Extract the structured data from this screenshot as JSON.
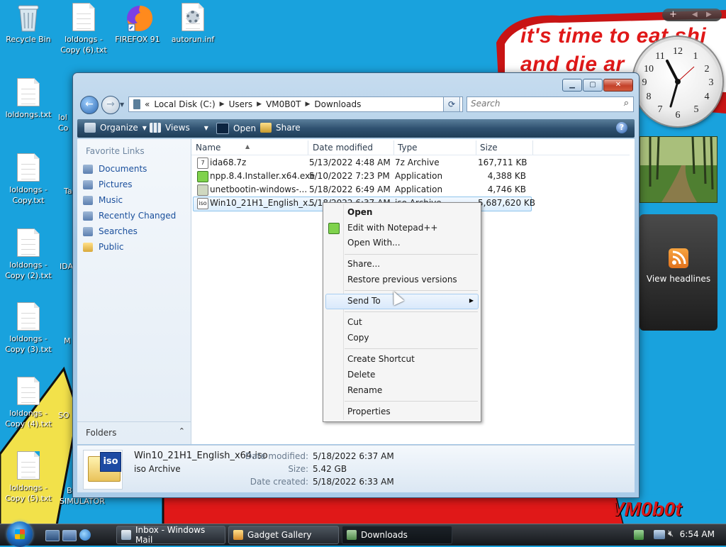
{
  "desktop": {
    "icons": [
      {
        "label": "Recycle Bin"
      },
      {
        "label": "loldongs - Copy (6).txt"
      },
      {
        "label": "FIREFOX 91"
      },
      {
        "label": "autorun.inf"
      },
      {
        "label": "loldongs.txt"
      },
      {
        "label": "loldongs - Copy.txt"
      },
      {
        "label": "loldongs - Copy (2).txt"
      },
      {
        "label": "loldongs - Copy (3).txt"
      },
      {
        "label": "loldongs - Copy (4).txt"
      },
      {
        "label": "loldongs - Copy (5).txt"
      }
    ],
    "partial_labels": [
      "lol",
      "Co",
      "Ta",
      "IDA",
      "M",
      "SO",
      "B",
      "SIMULATOR"
    ],
    "wallpaper_text": [
      "it's time to eat shi",
      "and die ar"
    ],
    "signature": "VM0b0t"
  },
  "gadgets": {
    "feed_label": "View headlines"
  },
  "window": {
    "caption_buttons": [
      "minimize",
      "maximize",
      "close"
    ],
    "address": {
      "chevron": "«",
      "segments": [
        "Local Disk (C:)",
        "Users",
        "VM0B0T",
        "Downloads"
      ]
    },
    "search_placeholder": "Search",
    "toolbar": {
      "organize": "Organize",
      "views": "Views",
      "open": "Open",
      "share": "Share"
    },
    "nav": {
      "header": "Favorite Links",
      "links": [
        "Documents",
        "Pictures",
        "Music",
        "Recently Changed",
        "Searches",
        "Public"
      ],
      "folders_label": "Folders"
    },
    "columns": [
      "Name",
      "Date modified",
      "Type",
      "Size"
    ],
    "files": [
      {
        "name": "ida68.7z",
        "date": "5/13/2022 4:48 AM",
        "type": "7z Archive",
        "size": "167,711 KB"
      },
      {
        "name": "npp.8.4.Installer.x64.exe",
        "date": "5/10/2022 7:23 PM",
        "type": "Application",
        "size": "4,388 KB"
      },
      {
        "name": "unetbootin-windows-...",
        "date": "5/18/2022 6:49 AM",
        "type": "Application",
        "size": "4,746 KB"
      },
      {
        "name": "Win10_21H1_English_x...",
        "date": "5/18/2022 6:37 AM",
        "type": "iso Archive",
        "size": "5,687,620 KB"
      }
    ],
    "details": {
      "filename": "Win10_21H1_English_x64.iso",
      "filetype": "iso Archive",
      "icon_text": "iso",
      "date_modified_label": "Date modified:",
      "date_modified": "5/18/2022 6:37 AM",
      "size_label": "Size:",
      "size": "5.42 GB",
      "date_created_label": "Date created:",
      "date_created": "5/18/2022 6:33 AM"
    }
  },
  "context_menu": {
    "open": "Open",
    "edit_npp": "Edit with Notepad++",
    "open_with": "Open With...",
    "share": "Share...",
    "restore": "Restore previous versions",
    "send_to": "Send To",
    "cut": "Cut",
    "copy": "Copy",
    "create_shortcut": "Create Shortcut",
    "delete": "Delete",
    "rename": "Rename",
    "properties": "Properties"
  },
  "taskbar": {
    "tasks": [
      "Inbox - Windows Mail",
      "Gadget Gallery",
      "Downloads"
    ],
    "time": "6:54 AM"
  },
  "colors": {
    "desktop_bg": "#19a2dd",
    "wallpaper_red": "#e01818",
    "link_blue": "#1a4f9c"
  }
}
